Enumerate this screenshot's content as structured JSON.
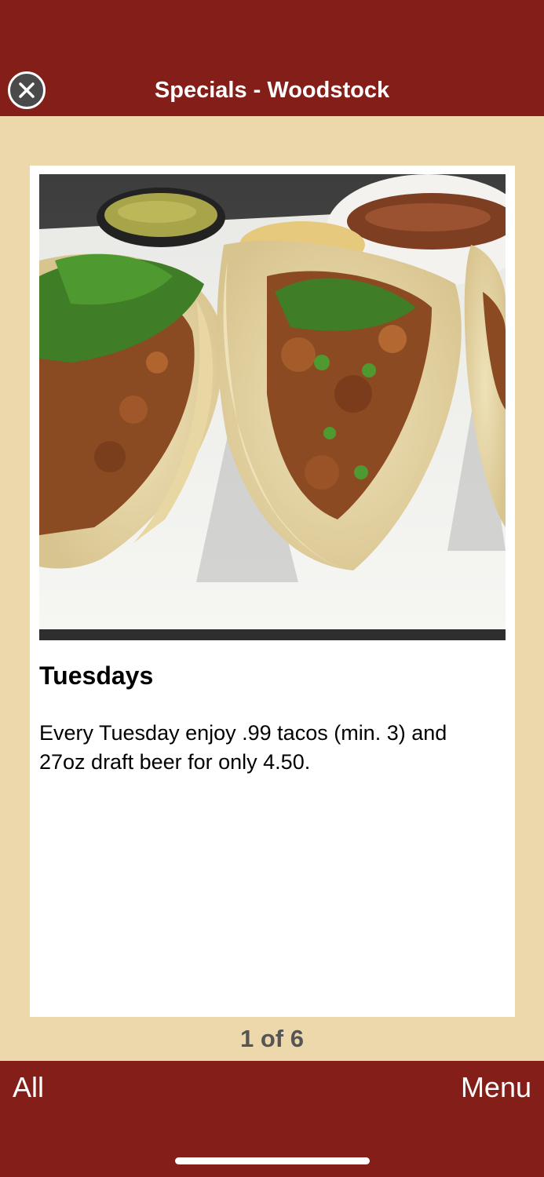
{
  "header": {
    "title": "Specials - Woodstock",
    "close_icon": "close-circle-icon"
  },
  "special": {
    "image": "tacos-photo",
    "title": "Tuesdays",
    "description": "Every Tuesday enjoy .99 tacos (min. 3) and 27oz draft beer for only 4.50."
  },
  "pager": {
    "label": "1 of 6"
  },
  "footer": {
    "left_label": "All",
    "right_label": "Menu"
  },
  "colors": {
    "brand": "#841e19",
    "background": "#ecd8ab",
    "card": "#ffffff"
  }
}
